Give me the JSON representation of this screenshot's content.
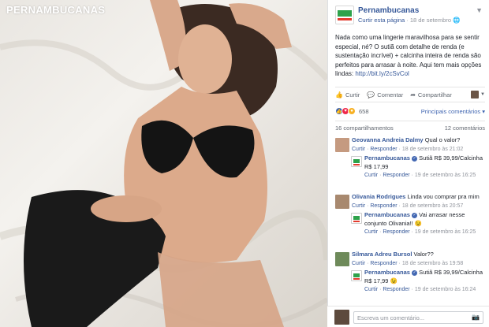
{
  "photo": {
    "watermark": "PERNAMBUCANAS"
  },
  "post": {
    "page_name": "Pernambucanas",
    "like_page": "Curtir esta página",
    "meta_sep": " · ",
    "date": "18 de setembro",
    "globe_icon": "globe-icon",
    "text": "Nada como uma lingerie maravilhosa para se sentir especial, né? O sutiã com detalhe de renda (e sustentação incrível) + calcinha inteira de renda são perfeitos para arrasar à noite. Aqui tem mais opções lindas: ",
    "link": "http://bit.ly/2cSvCol"
  },
  "actions": {
    "like": "Curtir",
    "comment": "Comentar",
    "share": "Compartilhar"
  },
  "reactions": {
    "count": "658",
    "top_comments": "Principais comentários ▾"
  },
  "stats": {
    "shares": "16 compartilhamentos",
    "comments": "12 comentários"
  },
  "comments": [
    {
      "author": "Geovanna Andreia Dalmy",
      "text": "Qual o valor?",
      "meta_like": "Curtir",
      "meta_reply": "Responder",
      "meta_date": "18 de setembro às 21:02",
      "reply": {
        "author": "Pernambucanas",
        "text": "Sutiã R$ 39,99/Calcinha R$ 17,99",
        "meta_like": "Curtir",
        "meta_reply": "Responder",
        "meta_date": "19 de setembro às 16:25"
      }
    },
    {
      "author": "Olivania Rodrigues",
      "text": "Linda vou comprar pra mim",
      "meta_like": "Curtir",
      "meta_reply": "Responder",
      "meta_date": "18 de setembro às 20:57",
      "reply": {
        "author": "Pernambucanas",
        "text": "Vai arrasar nesse conjunto Olivania!! 😉",
        "meta_like": "Curtir",
        "meta_reply": "Responder",
        "meta_date": "19 de setembro às 16:25"
      }
    },
    {
      "author": "Silmara Adreu Bursol",
      "text": "Valor??",
      "meta_like": "Curtir",
      "meta_reply": "Responder",
      "meta_date": "18 de setembro às 19:58",
      "reply": {
        "author": "Pernambucanas",
        "text": "Sutiã R$ 39,99/Calcinha R$ 17,99 😉",
        "meta_like": "Curtir",
        "meta_reply": "Responder",
        "meta_date": "19 de setembro às 16:24"
      }
    }
  ],
  "composer": {
    "placeholder": "Escreva um comentário..."
  }
}
